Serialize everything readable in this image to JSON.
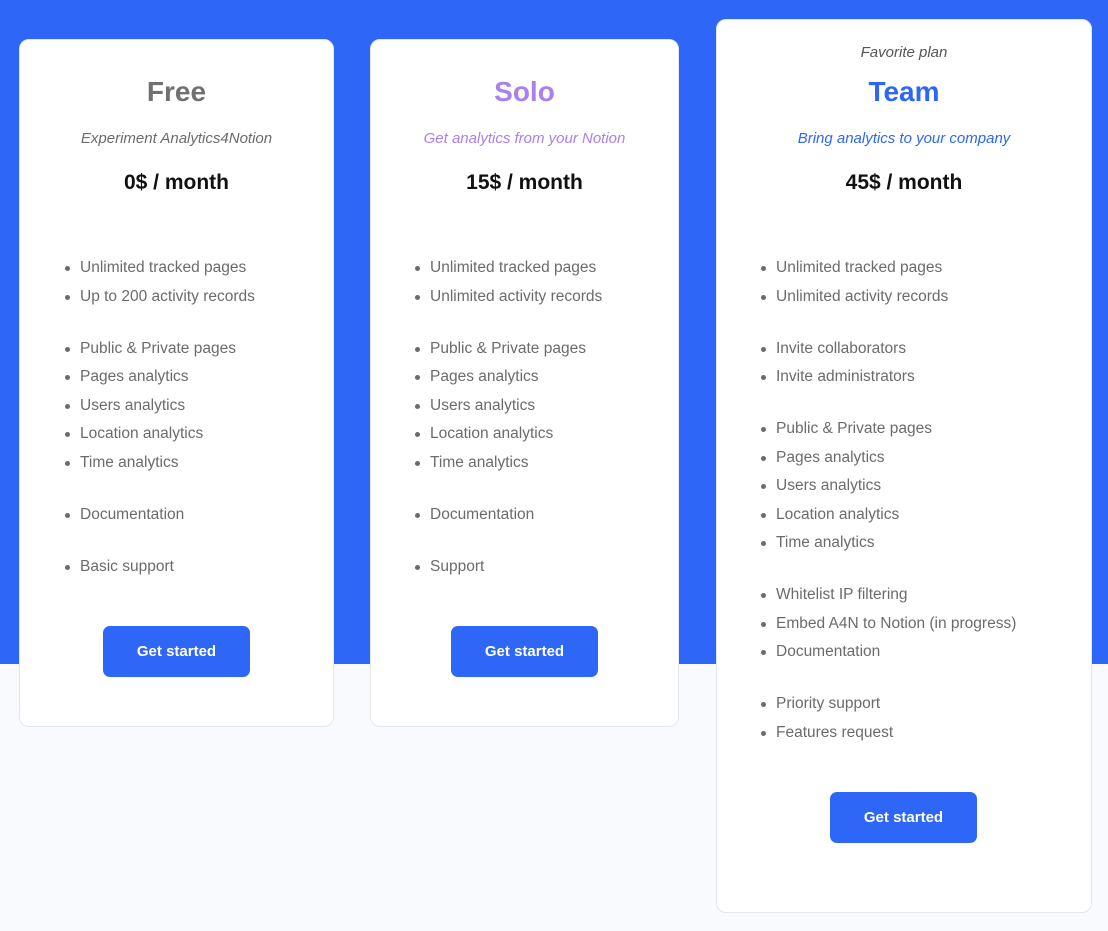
{
  "colors": {
    "accent": "#2e66f8",
    "solo_accent": "#a97ff1",
    "free_title": "#707070",
    "page_background": "#f9fafd",
    "card_background": "#ffffff",
    "feature_text": "#6b6b6b"
  },
  "plans": [
    {
      "id": "free",
      "name": "Free",
      "tagline": "Experiment Analytics4Notion",
      "price": "0$ / month",
      "feature_groups": [
        [
          "Unlimited tracked pages",
          "Up to 200 activity records"
        ],
        [
          "Public & Private pages",
          "Pages analytics",
          "Users analytics",
          "Location analytics",
          "Time analytics"
        ],
        [
          "Documentation"
        ],
        [
          "Basic support"
        ]
      ],
      "cta_label": "Get started"
    },
    {
      "id": "solo",
      "name": "Solo",
      "tagline": "Get analytics from your Notion",
      "price": "15$ / month",
      "feature_groups": [
        [
          "Unlimited tracked pages",
          "Unlimited activity records"
        ],
        [
          "Public & Private pages",
          "Pages analytics",
          "Users analytics",
          "Location analytics",
          "Time analytics"
        ],
        [
          "Documentation"
        ],
        [
          "Support"
        ]
      ],
      "cta_label": "Get started"
    },
    {
      "id": "team",
      "badge": "Favorite plan",
      "name": "Team",
      "tagline": "Bring analytics to your company",
      "price": "45$ / month",
      "feature_groups": [
        [
          "Unlimited tracked pages",
          "Unlimited activity records"
        ],
        [
          "Invite collaborators",
          "Invite administrators"
        ],
        [
          "Public & Private pages",
          "Pages analytics",
          "Users analytics",
          "Location analytics",
          "Time analytics"
        ],
        [
          "Whitelist IP filtering",
          "Embed A4N to Notion (in progress)",
          "Documentation"
        ],
        [
          "Priority support",
          "Features request"
        ]
      ],
      "cta_label": "Get started"
    }
  ]
}
